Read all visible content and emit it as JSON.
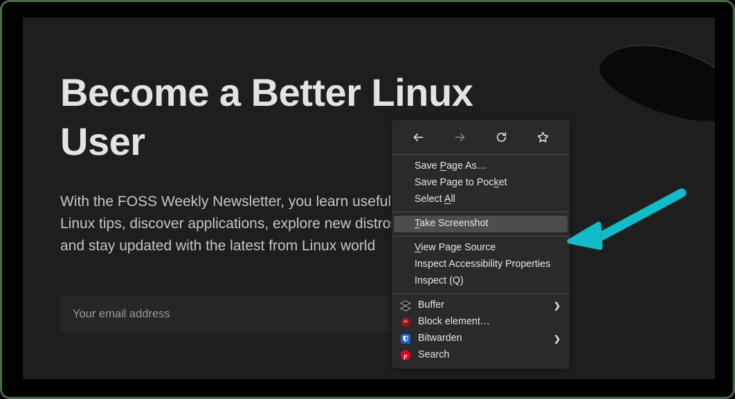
{
  "page": {
    "headline": "Become a Better Linux\nUser",
    "subtext": "With the FOSS Weekly Newsletter, you learn useful Linux tips, discover applications, explore new distros and stay updated with the latest from Linux world",
    "email_placeholder": "Your email address",
    "email_value": "",
    "background_color": "#1e1e1e",
    "text_color": "#e3e3e1"
  },
  "context_menu": {
    "background_color": "#2b2a2b",
    "highlight_color": "#4d4d4f",
    "nav_buttons": [
      {
        "name": "back",
        "icon": "back-arrow-icon",
        "enabled": true
      },
      {
        "name": "forward",
        "icon": "forward-arrow-icon",
        "enabled": false
      },
      {
        "name": "reload",
        "icon": "reload-icon",
        "enabled": true
      },
      {
        "name": "bookmark",
        "icon": "star-icon",
        "enabled": true
      }
    ],
    "group_one": [
      {
        "label": "Save Page As…",
        "accesskey": "P",
        "selected": false
      },
      {
        "label": "Save Page to Pocket",
        "accesskey": "k",
        "selected": false
      },
      {
        "label": "Select All",
        "accesskey": "A",
        "selected": false
      }
    ],
    "group_two": [
      {
        "label": "Take Screenshot",
        "accesskey": "T",
        "selected": true
      }
    ],
    "group_three": [
      {
        "label": "View Page Source",
        "accesskey": "V",
        "selected": false
      },
      {
        "label": "Inspect Accessibility Properties",
        "accesskey": "",
        "selected": false
      },
      {
        "label": "Inspect (Q)",
        "accesskey": "",
        "selected": false
      }
    ],
    "group_extensions": [
      {
        "label": "Buffer",
        "icon": "buffer-layers-icon",
        "submenu": true
      },
      {
        "label": "Block element…",
        "icon": "ublock-origin-shield-icon",
        "submenu": false
      },
      {
        "label": "Bitwarden",
        "icon": "bitwarden-shield-icon",
        "submenu": true
      },
      {
        "label": "Search",
        "icon": "pinterest-icon",
        "submenu": false
      }
    ]
  },
  "annotation": {
    "arrow_color": "#0fbcc8",
    "points_to": "Take Screenshot"
  },
  "frame": {
    "border_color": "#4a6b4a"
  }
}
